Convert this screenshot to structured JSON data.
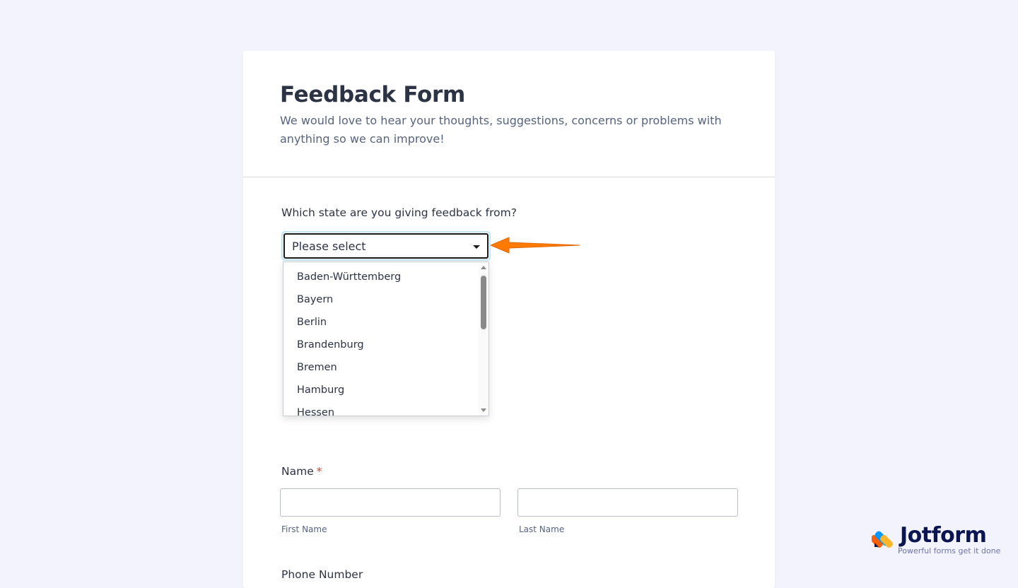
{
  "form": {
    "title": "Feedback Form",
    "subtitle": "We would love to hear your thoughts, suggestions, concerns or problems with anything so we can improve!"
  },
  "state_question": {
    "label": "Which state are you giving feedback from?",
    "selected": "Please select",
    "options": [
      "Baden-Württemberg",
      "Bayern",
      "Berlin",
      "Brandenburg",
      "Bremen",
      "Hamburg",
      "Hessen"
    ]
  },
  "name_field": {
    "label": "Name",
    "required_mark": "*",
    "first_sublabel": "First Name",
    "last_sublabel": "Last Name"
  },
  "next_question": {
    "label": "Phone Number"
  },
  "branding": {
    "name": "Jotform",
    "tagline": "Powerful forms get it done"
  },
  "colors": {
    "background": "#f3f3fe",
    "accent_arrow": "#ff7a00",
    "required": "#e53935"
  }
}
